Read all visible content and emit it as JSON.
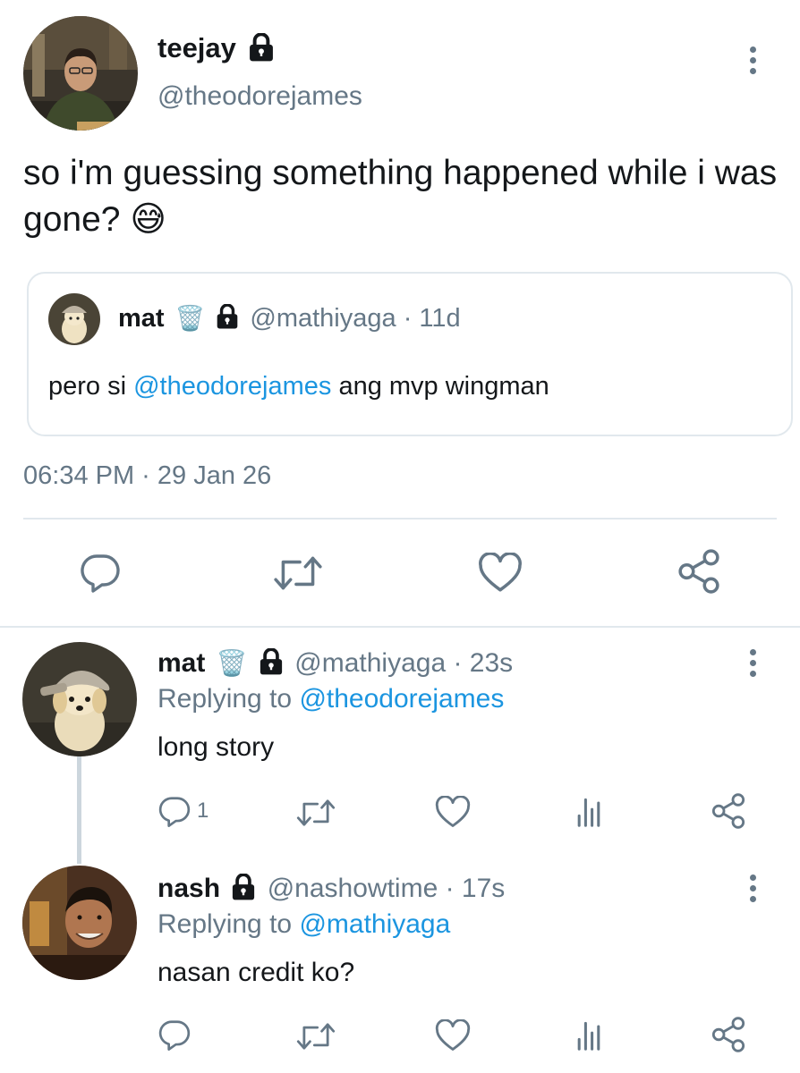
{
  "main_tweet": {
    "display_name": "teejay",
    "handle": "@theodorejames",
    "text": "so i'm guessing something happened while i was gone? 😅",
    "timestamp": "06:34 PM · 29 Jan 26",
    "avatar_icon": "avatar-teejay",
    "lock_icon": "lock-icon"
  },
  "quoted_tweet": {
    "display_name": "mat",
    "badge": "🗑️",
    "handle": "@mathiyaga",
    "time": "· 11d",
    "text_prefix": "pero si ",
    "mention": "@theodorejames",
    "text_suffix": " ang mvp wingman"
  },
  "replies": [
    {
      "display_name": "mat",
      "badge": "🗑️",
      "handle": "@mathiyaga",
      "time": "· 23s",
      "replying_prefix": "Replying to ",
      "replying_to": "@theodorejames",
      "text": "long story",
      "reply_count": "1"
    },
    {
      "display_name": "nash",
      "handle": "@nashowtime",
      "time": "· 17s",
      "replying_prefix": "Replying to ",
      "replying_to": "@mathiyaga",
      "text": "nasan credit ko?",
      "reply_count": ""
    }
  ],
  "colors": {
    "text": "#14171a",
    "secondary": "#657786",
    "link": "#1b95e0",
    "divider": "#e1e8ed"
  },
  "icons": [
    "reply-icon",
    "retweet-icon",
    "like-icon",
    "share-icon",
    "analytics-icon",
    "more-icon",
    "lock-icon"
  ]
}
